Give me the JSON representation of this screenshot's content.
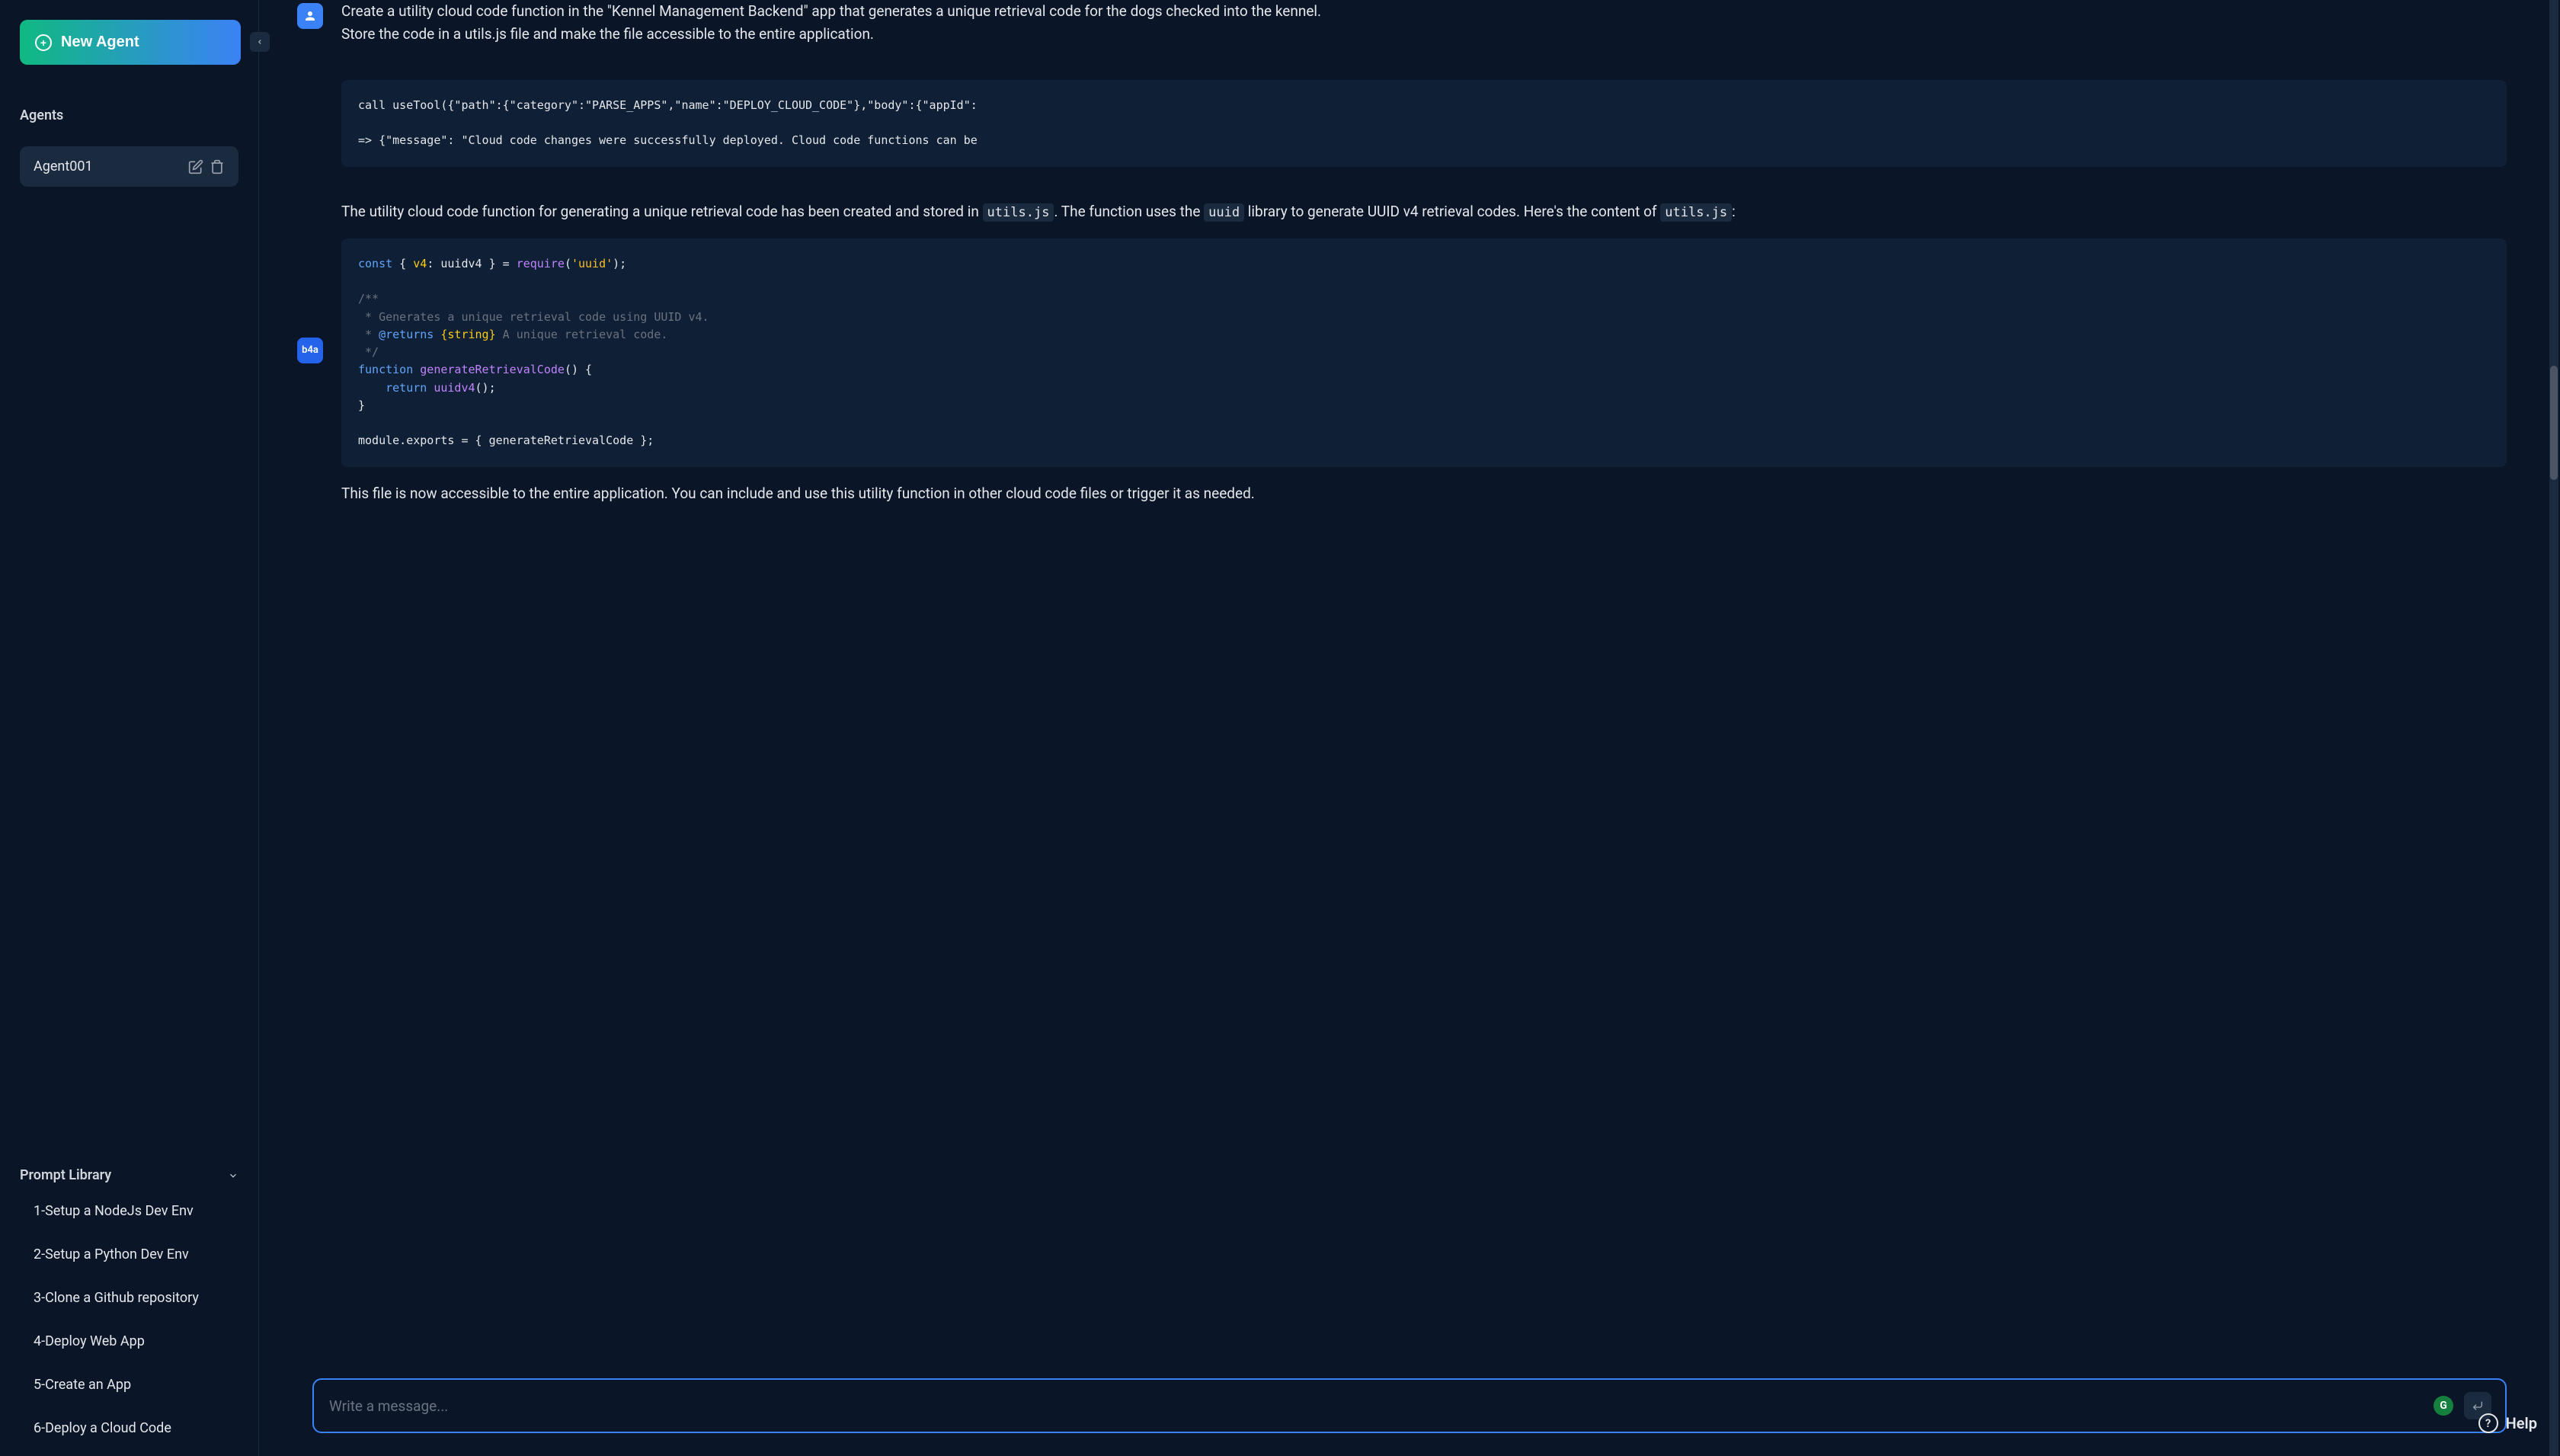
{
  "sidebar": {
    "new_agent_label": "New Agent",
    "agents_header": "Agents",
    "agent_name": "Agent001",
    "prompt_library_header": "Prompt Library",
    "prompts": [
      "1-Setup a NodeJs Dev Env",
      "2-Setup a Python Dev Env",
      "3-Clone a Github repository",
      "4-Deploy Web App",
      "5-Create an App",
      "6-Deploy a Cloud Code"
    ]
  },
  "chat": {
    "user_msg_line1": "Create a utility cloud code function in the \"Kennel Management Backend\" app that generates a unique retrieval code for the dogs checked into the kennel.",
    "user_msg_line2": "Store the code in a utils.js file and make the file accessible to the entire application.",
    "tool_call_line1": "call useTool({\"path\":{\"category\":\"PARSE_APPS\",\"name\":\"DEPLOY_CLOUD_CODE\"},\"body\":{\"appId\":",
    "tool_call_line2": "=> {\"message\": \"Cloud code changes were successfully deployed. Cloud code functions can be",
    "assistant_p1_a": "The utility cloud code function for generating a unique retrieval code has been created and stored in ",
    "assistant_p1_code1": "utils.js",
    "assistant_p1_b": ". The function uses the ",
    "assistant_p1_code2": "uuid",
    "assistant_p1_c": " library to generate UUID v4 retrieval codes. Here's the content of ",
    "assistant_p1_code3": "utils.js",
    "assistant_p1_d": ":",
    "assistant_p2": "This file is now accessible to the entire application. You can include and use this utility function in other cloud code files or trigger it as needed.",
    "b4a_label": "b4a"
  },
  "code": {
    "l1_const": "const",
    "l1_rest": " { ",
    "l1_v4": "v4",
    "l1_colon": ": uuidv4 } = ",
    "l1_require": "require",
    "l1_paren": "(",
    "l1_str": "'uuid'",
    "l1_end": ");",
    "l3": "/**",
    "l4": " * Generates a unique retrieval code using UUID v4.",
    "l5a": " * ",
    "l5b": "@returns",
    "l5c": " {string}",
    "l5d": " A unique retrieval code.",
    "l6": " */",
    "l7_function": "function",
    "l7_name": " generateRetrievalCode",
    "l7_parens": "() {",
    "l8_return": "    return",
    "l8_call": " uuidv4",
    "l8_end": "();",
    "l9": "}",
    "l11": "module.exports = { generateRetrievalCode };"
  },
  "input": {
    "placeholder": "Write a message..."
  },
  "help": {
    "label": "Help"
  }
}
